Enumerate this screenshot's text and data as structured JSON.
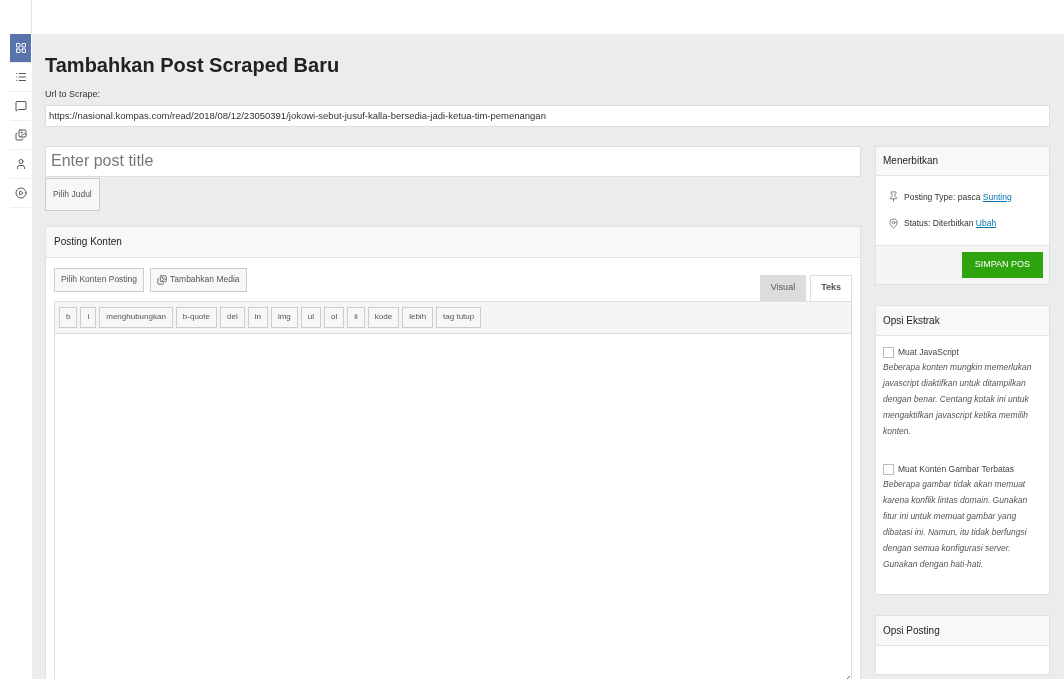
{
  "sidebar": {
    "items": [
      {
        "kind": "dashboard",
        "selected": true
      },
      {
        "kind": "list",
        "selected": false
      },
      {
        "kind": "comment",
        "selected": false
      },
      {
        "kind": "media",
        "selected": false
      },
      {
        "kind": "user",
        "selected": false
      },
      {
        "kind": "play",
        "selected": false
      }
    ]
  },
  "page": {
    "title": "Tambahkan Post Scraped Baru",
    "url_label": "Url to Scrape:",
    "url_value": "https://nasional.kompas.com/read/2018/08/12/23050391/jokowi-sebut-jusuf-kalla-bersedia-jadi-ketua-tim-pemenangan",
    "title_placeholder": "Enter post title",
    "pick_title_button": "Pilih Judul"
  },
  "content_box": {
    "title": "Posting Konten",
    "pick_content_button": "Pilih Konten Posting",
    "add_media_button": "Tambahkan Media",
    "tabs": [
      {
        "label": "Visual",
        "selected": false
      },
      {
        "label": "Teks",
        "selected": true
      }
    ],
    "quicktags": [
      "b",
      "i",
      "menghubungkan",
      "b-quote",
      "del",
      "in",
      "img",
      "ul",
      "ol",
      "li",
      "kode",
      "lebih",
      "tag tutup"
    ]
  },
  "publish_box": {
    "title": "Menerbitkan",
    "rows": [
      {
        "kind": "pin",
        "label": "Posting Type: pasca",
        "link": "Sunting"
      },
      {
        "kind": "key",
        "label": "Status: Diterbitkan",
        "link": "Ubah"
      }
    ],
    "save_button": "SIMPAN POS"
  },
  "extract_box": {
    "title": "Opsi Ekstrak",
    "options": [
      {
        "label": "Muat JavaScript",
        "checked": false,
        "description": "Beberapa konten mungkin memerlukan javascript diaktifkan untuk ditampilkan dengan benar. Centang kotak ini untuk mengaktifkan javascript ketika memilih konten."
      },
      {
        "label": "Muat Konten Gambar Terbatas",
        "checked": false,
        "description": "Beberapa gambar tidak akan memuat karena konflik lintas domain. Gunakan fitur ini untuk memuat gambar yang dibatasi ini. Namun, itu tidak berfungsi dengan semua konfigurasi server. Gunakan dengan hati-hati."
      }
    ]
  },
  "posting_box": {
    "title": "Opsi Posting"
  }
}
